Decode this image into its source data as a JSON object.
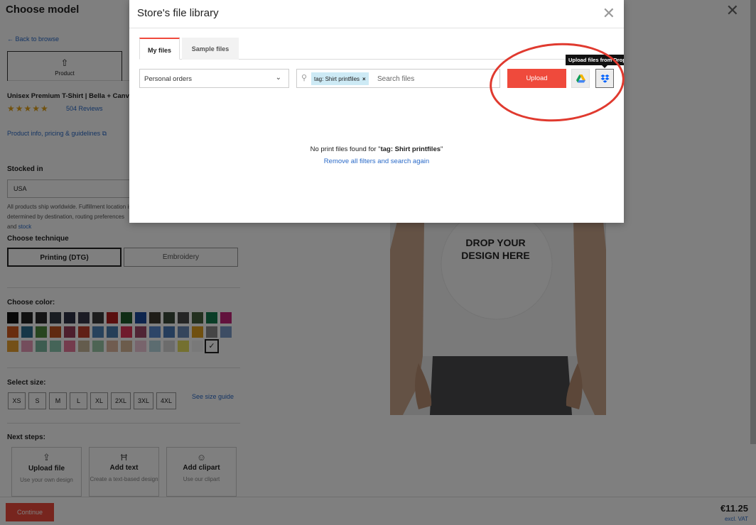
{
  "page": {
    "title": "Choose model",
    "back_link": "← Back to browse",
    "product_tab": "Product",
    "product_name": "Unisex Premium T-Shirt | Bella + Canvas",
    "stars": "★★★★★",
    "reviews": "504 Reviews",
    "product_info": "Product info, pricing & guidelines ⧉",
    "stocked_in_label": "Stocked in",
    "stocked_in_value": "USA",
    "shipping_text": "All products ship worldwide. Fulfillment location is determined by destination, routing preferences and ",
    "shipping_link": "stock",
    "technique_label": "Choose technique",
    "technique_dtg": "Printing (DTG)",
    "technique_embroidery": "Embroidery",
    "color_label": "Choose color:",
    "colors": [
      "#111111",
      "#222222",
      "#2b2b2b",
      "#333a44",
      "#2e3346",
      "#38394a",
      "#3a3a3a",
      "#b51e1e",
      "#1f5a2a",
      "#1d4a9c",
      "#3f3a30",
      "#3a4a3a",
      "#4a4a4a",
      "#47603f",
      "#157a4f",
      "#c4247a",
      "#d25a1f",
      "#2f6e8e",
      "#4f8a3f",
      "#c05520",
      "#9a3f5a",
      "#c0402f",
      "#4f84b8",
      "#4a7fb0",
      "#e0365a",
      "#a04a6a",
      "#5a8ad0",
      "#4a7ab8",
      "#6a8ab8",
      "#e0a020",
      "#8a8a8a",
      "#7a9ac8",
      "#e8a030",
      "#e89ab8",
      "#7ab8a0",
      "#8ac8b0",
      "#e8789a",
      "#c8b89a",
      "#9ac8a8",
      "#e0b8a0",
      "#d8b898",
      "#f0c8d8",
      "#b8d8e0",
      "#d8d8d8",
      "#e8e060",
      "#f2f2f2",
      "#ffffff"
    ],
    "selected_color_mark": "✓",
    "size_label": "Select size:",
    "sizes": [
      "XS",
      "S",
      "M",
      "L",
      "XL",
      "2XL",
      "3XL",
      "4XL"
    ],
    "size_guide": "See size guide",
    "next_steps_label": "Next steps:",
    "next_steps": [
      {
        "icon": "⇪",
        "title": "Upload file",
        "subtitle": "Use your own design"
      },
      {
        "icon": "Ħ",
        "title": "Add text",
        "subtitle": "Create a text-based design"
      },
      {
        "icon": "☺",
        "title": "Add clipart",
        "subtitle": "Use our clipart"
      }
    ],
    "continue": "Continue",
    "price": "€11.25",
    "vat": "excl. VAT",
    "drop_text": "DROP YOUR DESIGN HERE"
  },
  "modal": {
    "title": "Store's file library",
    "close": "✕",
    "tabs": [
      "My files",
      "Sample files"
    ],
    "select_value": "Personal orders",
    "chip": "tag: Shirt printfiles",
    "chip_remove": "×",
    "search_placeholder": "Search files",
    "upload": "Upload",
    "tooltip": "Upload files from Dropbox",
    "empty_prefix": "No print files found for \"",
    "empty_term": "tag: Shirt printfiles",
    "empty_suffix": "\"",
    "remove_filters": "Remove all filters and search again"
  },
  "colors": {
    "accent": "#ef4a3c",
    "link": "#2a6ac8",
    "annotation": "#e03a2f"
  }
}
